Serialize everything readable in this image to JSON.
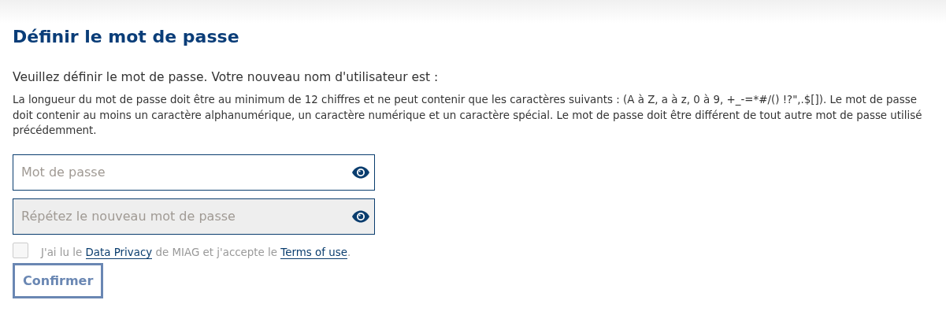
{
  "title": "Définir le mot de passe",
  "intro": "Veuillez définir le mot de passe. Votre nouveau nom d'utilisateur est :",
  "rules": "La longueur du mot de passe doit être au minimum de 12 chiffres et ne peut contenir que les caractères suivants : (A à Z, a à z, 0 à 9, +_-=*#/() !?\",.$[]). Le mot de passe doit contenir au moins un caractère alphanumérique, un caractère numérique et un caractère spécial. Le mot de passe doit être différent de tout autre mot de passe utilisé précédemment.",
  "fields": [
    {
      "placeholder": "Mot de passe",
      "disabled": false
    },
    {
      "placeholder": "Répétez le nouveau mot de passe",
      "disabled": true
    }
  ],
  "consent": {
    "checked": false,
    "disabled": true,
    "parts": [
      {
        "kind": "text",
        "text": "J'ai lu le "
      },
      {
        "kind": "link",
        "text": "Data Privacy"
      },
      {
        "kind": "text",
        "text": " de MIAG et j'accepte le "
      },
      {
        "kind": "link",
        "text": "Terms of use"
      },
      {
        "kind": "text",
        "text": "."
      }
    ]
  },
  "button": {
    "label": "Confirmer",
    "disabled": true
  }
}
